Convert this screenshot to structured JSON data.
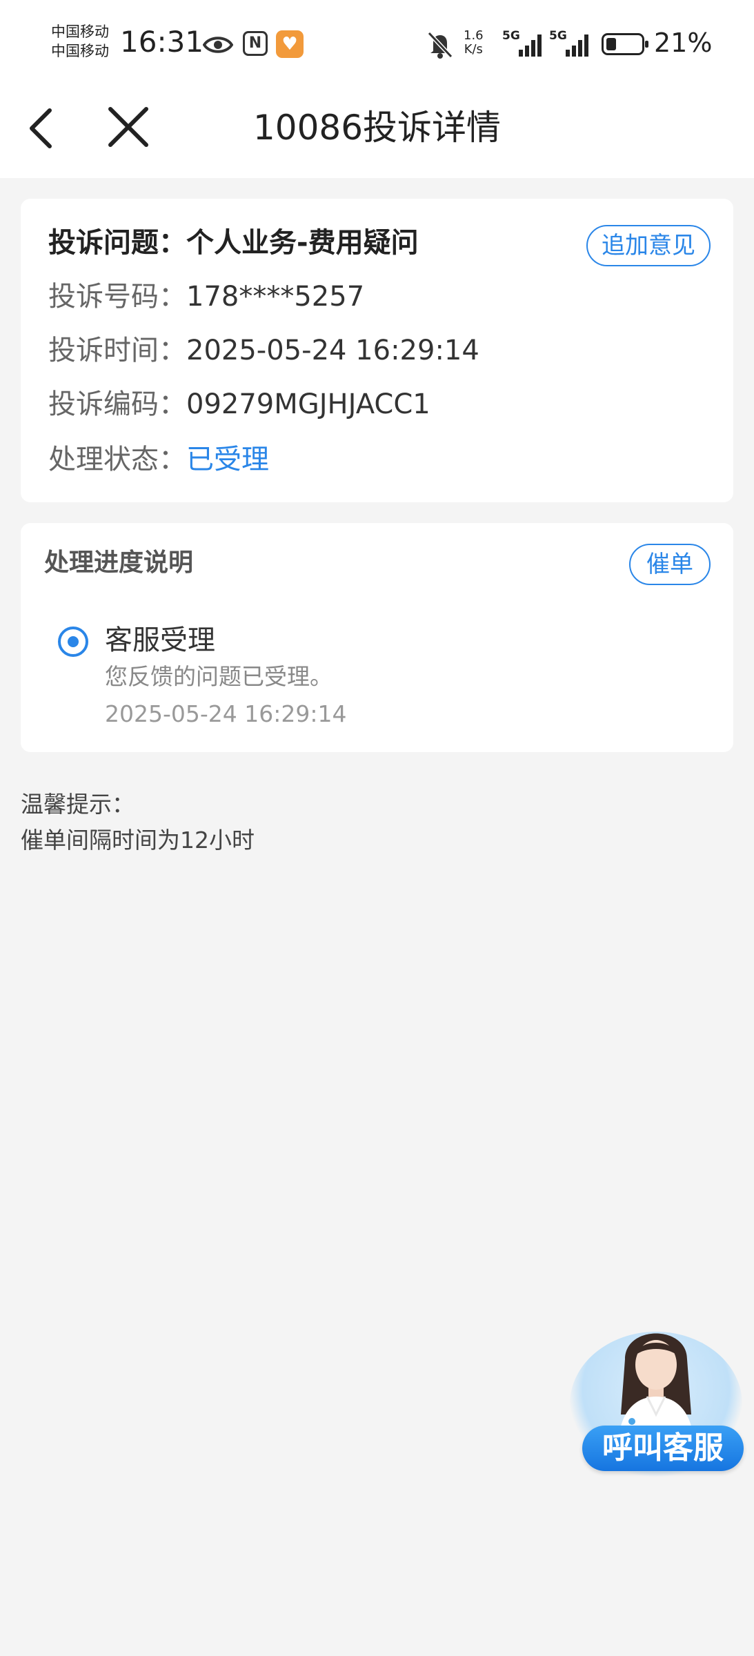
{
  "status_bar": {
    "carrier_1": "中国移动",
    "carrier_2": "中国移动",
    "time": "16:31",
    "speed_value": "1.6",
    "speed_unit": "K/s",
    "network_1": "5G",
    "network_2": "5G",
    "battery_level": 0.21,
    "battery_percent": "21%",
    "icons": [
      "eye-icon",
      "nfc-icon",
      "app-icon",
      "bell-muted-icon",
      "signal-icon",
      "battery-icon"
    ]
  },
  "navbar": {
    "title": "10086投诉详情",
    "back_icon": "chevron-left-icon",
    "close_icon": "close-icon"
  },
  "complaint": {
    "issue_label": "投诉问题：",
    "issue_value": "个人业务-费用疑问",
    "add_opinion_button": "追加意见",
    "number_label": "投诉号码：",
    "number_value": "178****5257",
    "time_label": "投诉时间：",
    "time_value": "2025-05-24 16:29:14",
    "code_label": "投诉编码：",
    "code_value": "09279MGJHJACC1",
    "status_label": "处理状态：",
    "status_value": "已受理"
  },
  "progress": {
    "title": "处理进度说明",
    "urge_button": "催单",
    "steps": [
      {
        "title": "客服受理",
        "description": "您反馈的问题已受理。",
        "time": "2025-05-24 16:29:14"
      }
    ]
  },
  "tips": {
    "heading": "温馨提示：",
    "line_1": "催单间隔时间为12小时"
  },
  "service_fab": {
    "label": "呼叫客服"
  },
  "colors": {
    "accent": "#2a86e8",
    "background": "#f4f4f4",
    "card": "#ffffff"
  }
}
